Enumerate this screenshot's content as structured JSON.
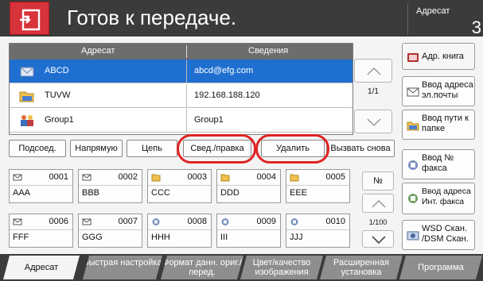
{
  "header": {
    "title": "Готов к передаче.",
    "dest_label": "Адресат",
    "dest_count": "3"
  },
  "table": {
    "col_dest": "Адресат",
    "col_info": "Сведения",
    "rows": [
      {
        "name": "ABCD",
        "info": "abcd@efg.com",
        "icon": "email-icon",
        "selected": true
      },
      {
        "name": "TUVW",
        "info": "192.168.188.120",
        "icon": "folder-icon",
        "selected": false
      },
      {
        "name": "Group1",
        "info": "Group1",
        "icon": "group-icon",
        "selected": false
      }
    ],
    "page": "1/1"
  },
  "right_buttons": [
    {
      "label": "Адр. книга",
      "icon": "address-book-icon"
    },
    {
      "label": "Ввод адреса эл.почты",
      "icon": "email-icon"
    },
    {
      "label": "Ввод пути к папке",
      "icon": "folder-icon"
    },
    {
      "label": "Ввод № факса",
      "icon": "fax-icon"
    },
    {
      "label": "Ввод адреса Инт. факса",
      "icon": "ifax-icon"
    },
    {
      "label": "WSD Скан. /DSM Скан.",
      "icon": "wsd-icon"
    }
  ],
  "func_buttons": [
    "Подсоед.",
    "Напрямую",
    "Цепь",
    "Свед./правка",
    "Удалить",
    "Вызвать снова"
  ],
  "grid": [
    {
      "num": "0001",
      "name": "AAA",
      "icon": "email-icon"
    },
    {
      "num": "0002",
      "name": "BBB",
      "icon": "email-icon"
    },
    {
      "num": "0003",
      "name": "CCC",
      "icon": "folder-icon"
    },
    {
      "num": "0004",
      "name": "DDD",
      "icon": "folder-icon"
    },
    {
      "num": "0005",
      "name": "EEE",
      "icon": "folder-icon"
    },
    {
      "num": "0006",
      "name": "FFF",
      "icon": "email-icon"
    },
    {
      "num": "0007",
      "name": "GGG",
      "icon": "email-icon"
    },
    {
      "num": "0008",
      "name": "HHH",
      "icon": "fax-icon"
    },
    {
      "num": "0009",
      "name": "III",
      "icon": "fax-icon"
    },
    {
      "num": "0010",
      "name": "JJJ",
      "icon": "fax-icon"
    }
  ],
  "grid_nav": {
    "number_label": "№",
    "page": "1/100"
  },
  "tabs": [
    "Адресат",
    "Быстрая настройка",
    "Формат данн. ориг./перед.",
    "Цвет/качество изображения",
    "Расширенная установка",
    "Программа"
  ],
  "colors": {
    "header": "#3b3b3b",
    "home": "#d8323a",
    "selected_row": "#1f6fd1",
    "highlight_ring": "#e02424"
  }
}
